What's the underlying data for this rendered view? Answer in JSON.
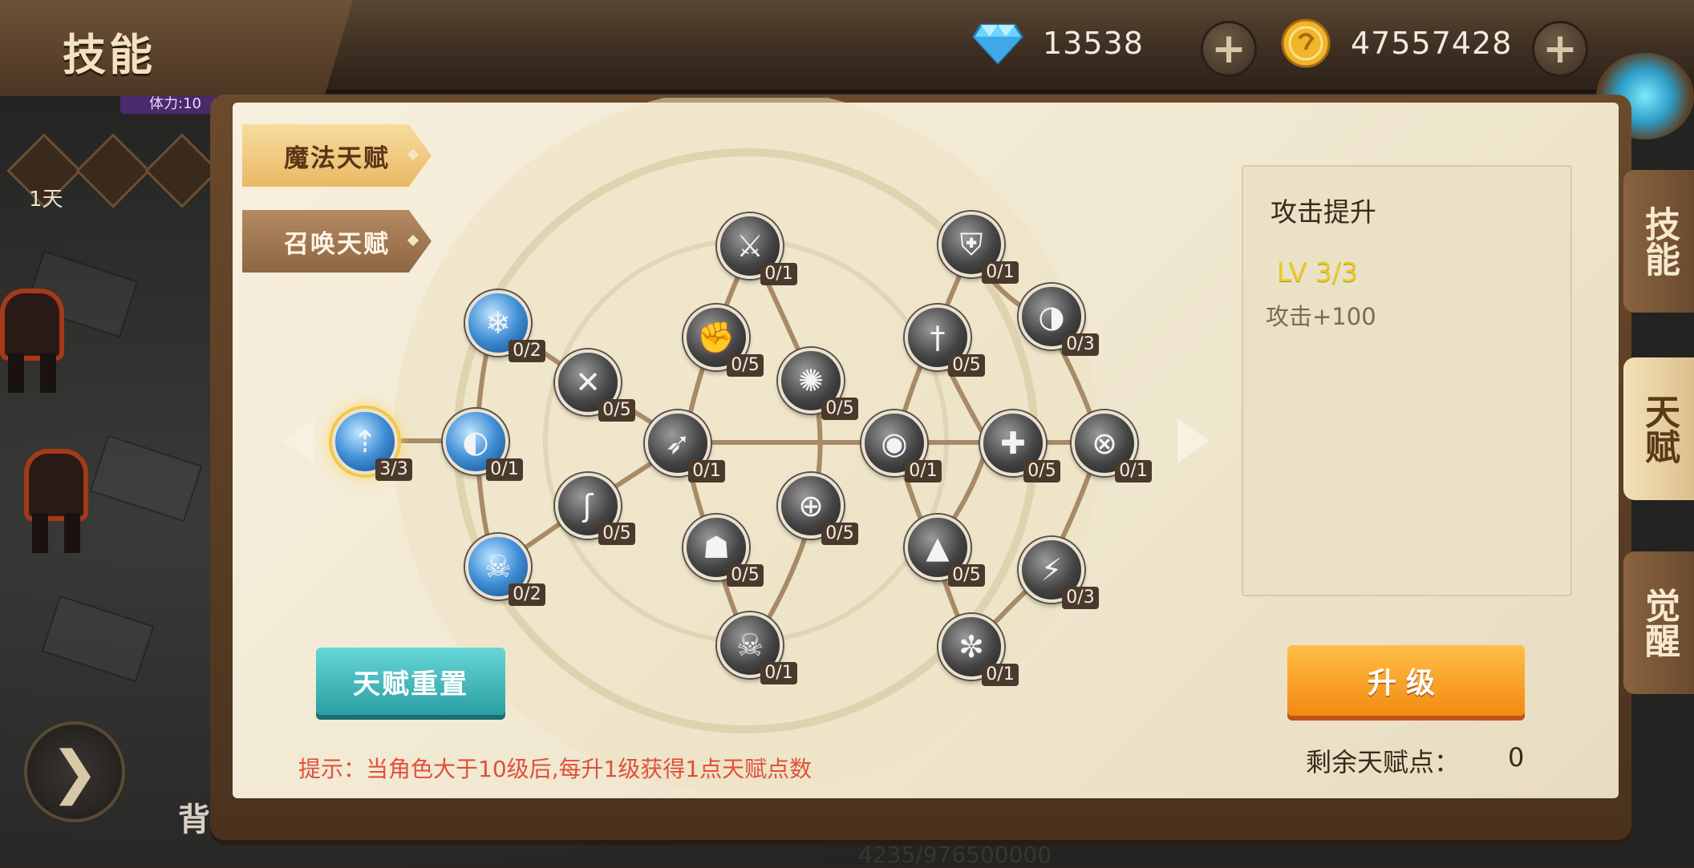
{
  "header": {
    "title": "技能",
    "diamonds": "13538",
    "gold": "47557428",
    "stamina_label": "体力:10"
  },
  "left_hud": {
    "days": "1天",
    "exp": "4235/976500000",
    "bag_char": "背"
  },
  "talent_tabs": [
    {
      "label": "魔法天赋",
      "active": true
    },
    {
      "label": "召唤天赋",
      "active": false
    }
  ],
  "nodes": [
    {
      "id": "attack-up",
      "level": "3/3",
      "active": true,
      "selected": true
    },
    {
      "id": "n2",
      "level": "0/1",
      "active": true
    },
    {
      "id": "n3",
      "level": "0/2",
      "active": true
    },
    {
      "id": "n4",
      "level": "0/2",
      "active": true
    },
    {
      "id": "n5",
      "level": "0/5"
    },
    {
      "id": "n6",
      "level": "0/5"
    },
    {
      "id": "n7",
      "level": "0/1"
    },
    {
      "id": "n8",
      "level": "0/5"
    },
    {
      "id": "n9",
      "level": "0/5"
    },
    {
      "id": "n10",
      "level": "0/1"
    },
    {
      "id": "n11",
      "level": "0/5"
    },
    {
      "id": "n12",
      "level": "0/5"
    },
    {
      "id": "n13",
      "level": "0/1"
    },
    {
      "id": "n14",
      "level": "0/1"
    },
    {
      "id": "n15",
      "level": "0/1"
    },
    {
      "id": "n16",
      "level": "0/5"
    },
    {
      "id": "n17",
      "level": "0/5"
    },
    {
      "id": "n18",
      "level": "0/3"
    },
    {
      "id": "n19",
      "level": "0/5"
    },
    {
      "id": "n20",
      "level": "0/1"
    },
    {
      "id": "n21",
      "level": "0/3"
    },
    {
      "id": "n22",
      "level": "0/1"
    }
  ],
  "info": {
    "name": "攻击提升",
    "level": "LV 3/3",
    "effect": "攻击+100"
  },
  "buttons": {
    "reset": "天赋重置",
    "upgrade": "升级"
  },
  "hint": "提示：当角色大于10级后,每升1级获得1点天赋点数",
  "points": {
    "label": "剩余天赋点：",
    "value": "0"
  },
  "side_tabs": [
    {
      "label": "技能",
      "active": false
    },
    {
      "label": "天赋",
      "active": true
    },
    {
      "label": "觉醒",
      "active": false
    }
  ],
  "colors": {
    "accent_gold": "#e7cd2b",
    "hint_red": "#e0503a",
    "reset_teal": "#2a9ea3",
    "upgrade_orange": "#f28a12"
  }
}
